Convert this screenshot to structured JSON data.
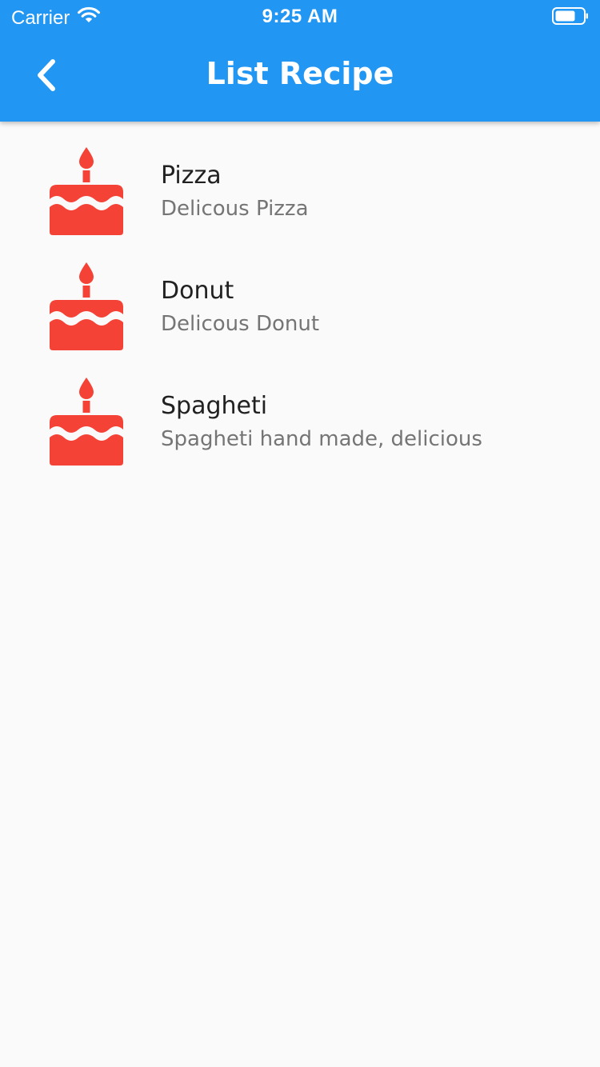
{
  "status_bar": {
    "carrier": "Carrier",
    "time": "9:25 AM"
  },
  "app_bar": {
    "title": "List Recipe"
  },
  "recipes": [
    {
      "title": "Pizza",
      "subtitle": "Delicous Pizza",
      "icon": "birthday-cake-icon"
    },
    {
      "title": "Donut",
      "subtitle": "Delicous Donut",
      "icon": "birthday-cake-icon"
    },
    {
      "title": "Spagheti",
      "subtitle": "Spagheti hand made, delicious",
      "icon": "birthday-cake-icon"
    }
  ],
  "colors": {
    "primary": "#2196f3",
    "icon": "#f44336",
    "background": "#fafafa",
    "title_text": "#212121",
    "subtitle_text": "#757575"
  }
}
